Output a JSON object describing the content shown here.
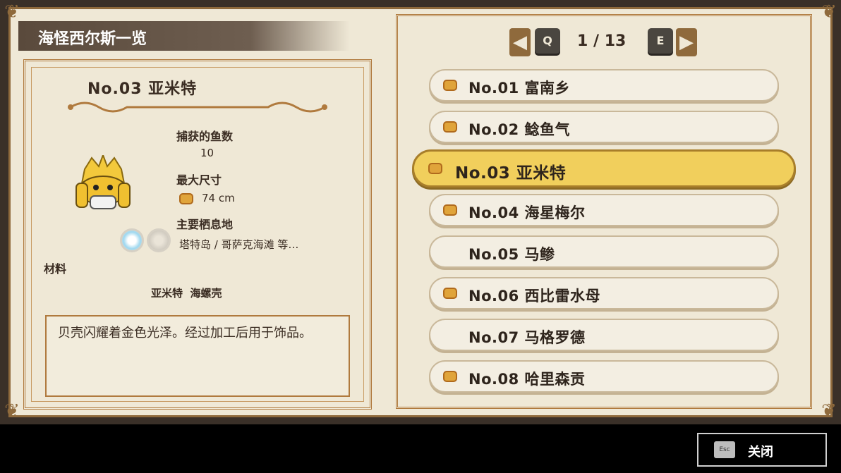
{
  "header": {
    "title": "海怪西尔斯一览"
  },
  "detail": {
    "name": "No.03 亚米特",
    "catch_label": "捕获的鱼数",
    "catch_value": "10",
    "max_size_label": "最大尺寸",
    "max_size_value": "74 cm",
    "habitat_label": "主要栖息地",
    "habitat_value": "塔特岛 / 哥萨克海滩 等…",
    "materials_label": "材料",
    "materials_value": "亚米特  海螺壳",
    "description": "贝壳闪耀着金色光泽。经过加工后用于饰品。"
  },
  "pager": {
    "prev_key": "Q",
    "next_key": "E",
    "current": "1",
    "separator": "/",
    "total": "13"
  },
  "list": [
    {
      "label": "No.01 富南乡",
      "crown": true,
      "selected": false
    },
    {
      "label": "No.02 鲶鱼气",
      "crown": true,
      "selected": false
    },
    {
      "label": "No.03 亚米特",
      "crown": true,
      "selected": true
    },
    {
      "label": "No.04 海星梅尔",
      "crown": true,
      "selected": false
    },
    {
      "label": "No.05 马鲹",
      "crown": false,
      "selected": false
    },
    {
      "label": "No.06 西比雷水母",
      "crown": true,
      "selected": false
    },
    {
      "label": "No.07 马格罗德",
      "crown": false,
      "selected": false
    },
    {
      "label": "No.08 哈里森贡",
      "crown": true,
      "selected": false
    }
  ],
  "footer": {
    "close_key": "Esc",
    "close_label": "关闭"
  },
  "colors": {
    "frame": "#b07a3e",
    "selected": "#f1cf5c",
    "crown": "#e0a43a"
  }
}
